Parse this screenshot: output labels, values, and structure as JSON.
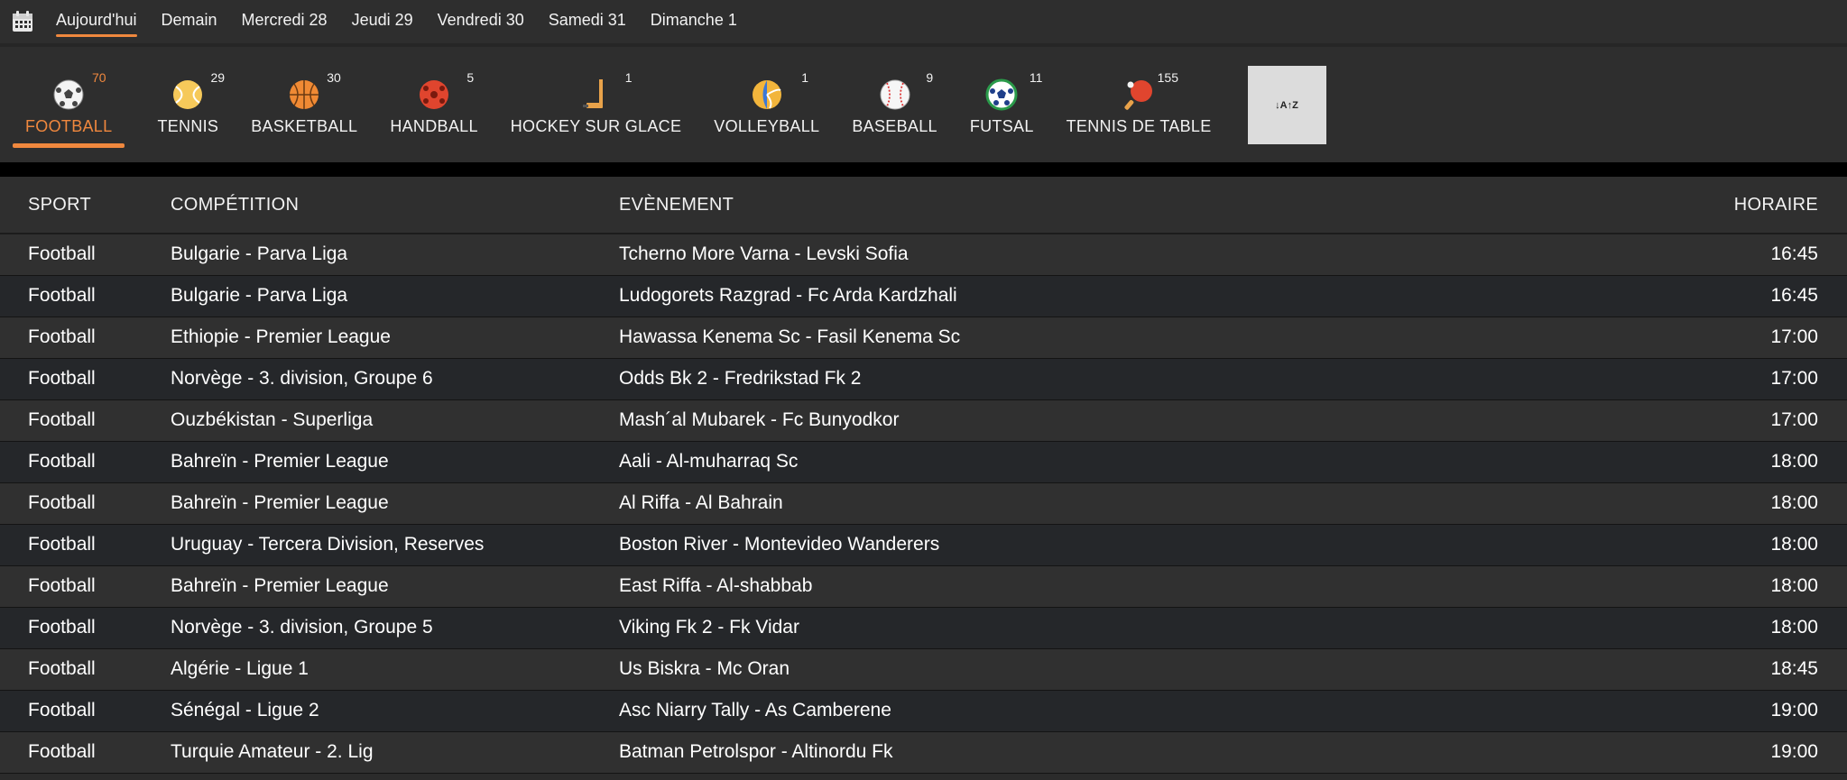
{
  "days": [
    {
      "label": "Aujourd'hui",
      "active": true
    },
    {
      "label": "Demain"
    },
    {
      "label": "Mercredi 28"
    },
    {
      "label": "Jeudi 29"
    },
    {
      "label": "Vendredi 30"
    },
    {
      "label": "Samedi 31"
    },
    {
      "label": "Dimanche 1"
    }
  ],
  "sports": [
    {
      "label": "FOOTBALL",
      "count": "70",
      "icon": "soccer-ball-icon",
      "active": true
    },
    {
      "label": "TENNIS",
      "count": "29",
      "icon": "tennis-ball-icon"
    },
    {
      "label": "BASKETBALL",
      "count": "30",
      "icon": "basketball-icon"
    },
    {
      "label": "HANDBALL",
      "count": "5",
      "icon": "handball-icon"
    },
    {
      "label": "HOCKEY SUR GLACE",
      "count": "1",
      "icon": "hockey-stick-icon"
    },
    {
      "label": "VOLLEYBALL",
      "count": "1",
      "icon": "volleyball-icon"
    },
    {
      "label": "BASEBALL",
      "count": "9",
      "icon": "baseball-icon"
    },
    {
      "label": "FUTSAL",
      "count": "11",
      "icon": "futsal-ball-icon"
    },
    {
      "label": "TENNIS DE TABLE",
      "count": "155",
      "icon": "ping-pong-paddle-icon"
    }
  ],
  "sort_button": {
    "label": "↓A↑Z",
    "icon": "sort-az-icon"
  },
  "table": {
    "headers": {
      "sport": "SPORT",
      "competition": "COMPÉTITION",
      "event": "EVÈNEMENT",
      "time": "HORAIRE"
    },
    "rows": [
      {
        "sport": "Football",
        "competition": "Bulgarie - Parva Liga",
        "event": "Tcherno More Varna - Levski Sofia",
        "time": "16:45"
      },
      {
        "sport": "Football",
        "competition": "Bulgarie - Parva Liga",
        "event": "Ludogorets Razgrad - Fc Arda Kardzhali",
        "time": "16:45"
      },
      {
        "sport": "Football",
        "competition": "Ethiopie - Premier League",
        "event": "Hawassa Kenema Sc - Fasil Kenema Sc",
        "time": "17:00"
      },
      {
        "sport": "Football",
        "competition": "Norvège - 3. division, Groupe 6",
        "event": "Odds Bk 2 - Fredrikstad Fk 2",
        "time": "17:00"
      },
      {
        "sport": "Football",
        "competition": "Ouzbékistan - Superliga",
        "event": "Mash´al Mubarek - Fc Bunyodkor",
        "time": "17:00"
      },
      {
        "sport": "Football",
        "competition": "Bahreïn - Premier League",
        "event": "Aali - Al-muharraq Sc",
        "time": "18:00"
      },
      {
        "sport": "Football",
        "competition": "Bahreïn - Premier League",
        "event": "Al Riffa - Al Bahrain",
        "time": "18:00"
      },
      {
        "sport": "Football",
        "competition": "Uruguay - Tercera Division, Reserves",
        "event": "Boston River - Montevideo Wanderers",
        "time": "18:00"
      },
      {
        "sport": "Football",
        "competition": "Bahreïn - Premier League",
        "event": "East Riffa - Al-shabbab",
        "time": "18:00"
      },
      {
        "sport": "Football",
        "competition": "Norvège - 3. division, Groupe 5",
        "event": "Viking Fk 2 - Fk Vidar",
        "time": "18:00"
      },
      {
        "sport": "Football",
        "competition": "Algérie - Ligue 1",
        "event": "Us Biskra - Mc Oran",
        "time": "18:45"
      },
      {
        "sport": "Football",
        "competition": "Sénégal - Ligue 2",
        "event": "Asc Niarry Tally - As Camberene",
        "time": "19:00"
      },
      {
        "sport": "Football",
        "competition": "Turquie Amateur - 2. Lig",
        "event": "Batman Petrolspor - Altinordu Fk",
        "time": "19:00"
      }
    ]
  }
}
